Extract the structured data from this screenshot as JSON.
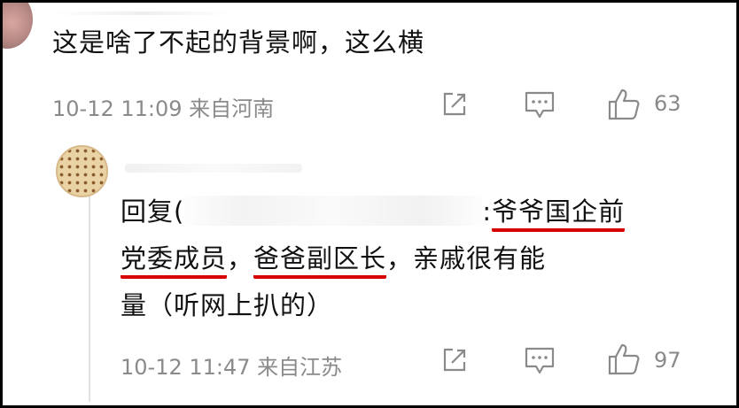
{
  "comment": {
    "text": "这是啥了不起的背景啊，这么横",
    "time": "10-12 11:09",
    "location": "来自河南",
    "likes": "63"
  },
  "reply": {
    "prefix": "回复(",
    "after_name": ":",
    "seg1_highlight": "爷爷国企前",
    "seg2_highlight": "党委成员",
    "seg2_rest": "，",
    "seg3_highlight": "爸爸副区长",
    "seg3_rest": "，亲戚很有能",
    "line3": "量（听网上扒的）",
    "time": "10-12 11:47",
    "location": "来自江苏",
    "likes": "97"
  },
  "colors": {
    "highlight": "#d60000",
    "meta": "#8a8a8a",
    "text": "#111111"
  },
  "icons": [
    "share-icon",
    "comment-icon",
    "thumbs-up-icon"
  ]
}
